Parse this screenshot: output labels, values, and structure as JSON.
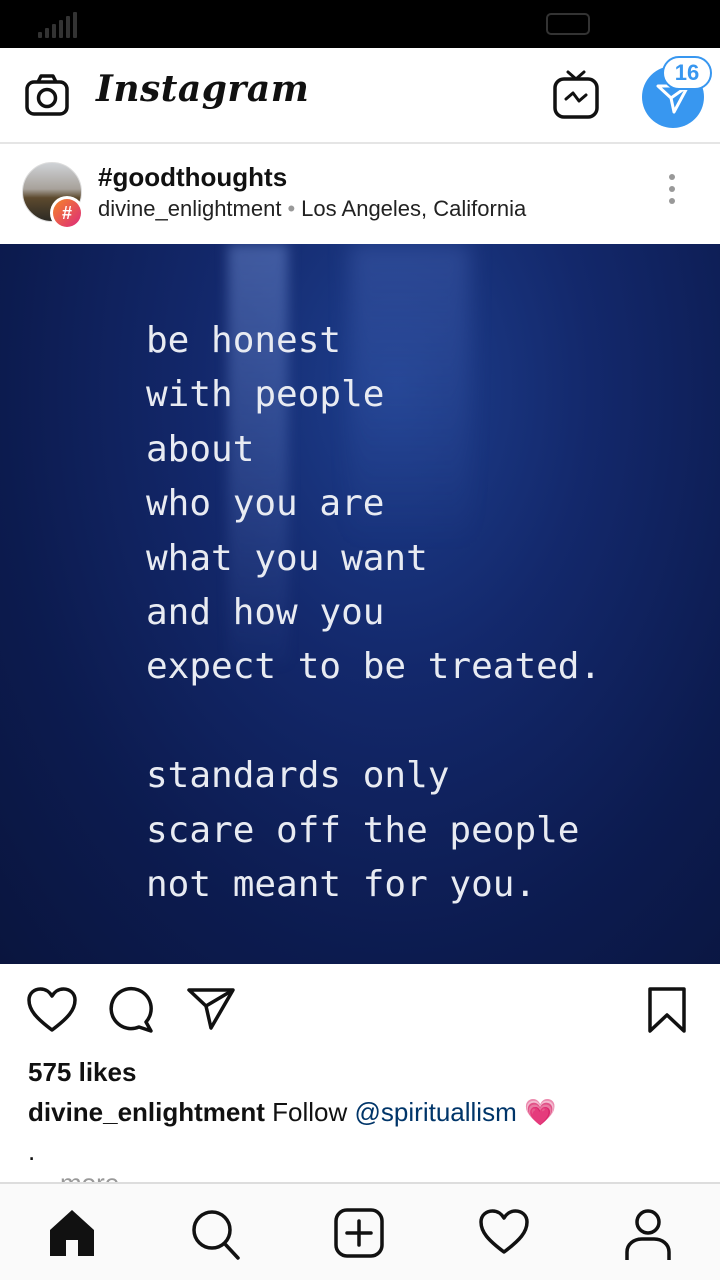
{
  "app": {
    "name": "Instagram"
  },
  "header": {
    "logo_text": "Instagram",
    "direct_badge_count": "16"
  },
  "post": {
    "title": "#goodthoughts",
    "username": "divine_enlightment",
    "separator": "•",
    "location": "Los Angeles, California",
    "image_text": "be honest\nwith people\nabout\nwho you are\nwhat you want\nand how you\nexpect to be treated.\n\nstandards only\nscare off the people\nnot meant for you.",
    "likes": "575 likes",
    "caption": {
      "username": "divine_enlightment",
      "text": "Follow",
      "mention": "@spirituallism",
      "emoji": "💗",
      "second_line": ".",
      "more": "more"
    }
  },
  "colors": {
    "accent": "#3897f0",
    "mention": "#003569",
    "image_background": "#0c1b4f"
  },
  "icons": {
    "top": [
      "camera-icon",
      "igtv-icon",
      "direct-message-icon"
    ],
    "post": [
      "heart-icon",
      "comment-icon",
      "share-icon",
      "bookmark-icon",
      "more-options-icon"
    ],
    "nav": [
      "home-icon",
      "search-icon",
      "add-post-icon",
      "activity-icon",
      "profile-icon"
    ]
  }
}
